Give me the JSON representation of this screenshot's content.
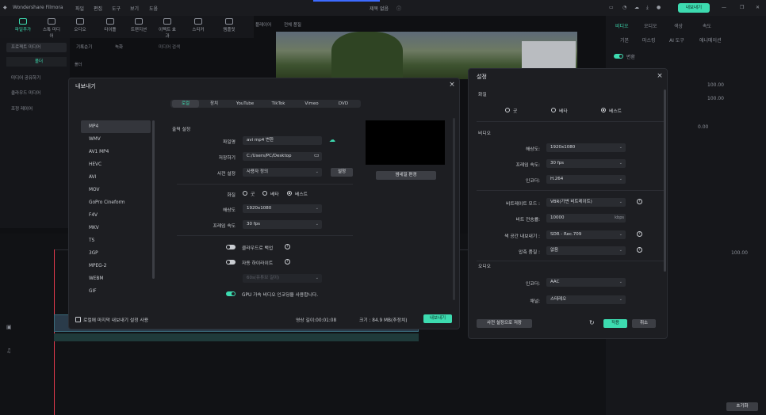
{
  "app": {
    "name": "Wondershare Filmora",
    "menu": [
      "파일",
      "편집",
      "도구",
      "보기",
      "도움"
    ],
    "title": "제목 없음",
    "export_button": "내보내기",
    "accent": "#3ddbb0"
  },
  "toolbar": {
    "items": [
      "파일추가",
      "스톡 미디어",
      "오디오",
      "타이틀",
      "트랜지션",
      "이펙트 효과",
      "스티커",
      "템플릿"
    ]
  },
  "left_panel": {
    "items": [
      "프로젝트 미디어",
      "폴더",
      "미디어 공유하기",
      "클라우드 미디어",
      "조정 레이어"
    ],
    "sort_label": "기록순기",
    "filter_label": "녹화",
    "search_placeholder": "미디어 검색",
    "folder_label": "폴더"
  },
  "preview_bar": {
    "player_label": "플레이어",
    "quality_label": "전체 품질"
  },
  "right_panel": {
    "tabs": [
      "비디오",
      "오디오",
      "색상",
      "속도"
    ],
    "subtabs": [
      "기본",
      "마스킹",
      "AI 도구",
      "애니메이션"
    ],
    "transform_label": "변환",
    "values": [
      "100.00",
      "100.00",
      "0.00",
      "100.00"
    ],
    "footer_button": "초기화"
  },
  "export_dialog": {
    "title": "내보내기",
    "tabs": [
      "로컬",
      "장치",
      "YouTube",
      "TikTok",
      "Vimeo",
      "DVD"
    ],
    "active_tab": "로컬",
    "formats": [
      "MP4",
      "WMV",
      "AV1 MP4",
      "HEVC",
      "AVI",
      "MOV",
      "GoPro Cineform",
      "F4V",
      "MKV",
      "TS",
      "3GP",
      "MPEG-2",
      "WEBM",
      "GIF"
    ],
    "selected_format": "MP4",
    "section_title": "출력 설정",
    "labels": {
      "filename": "파일명",
      "save_to": "저장하기",
      "preset": "사전 설정",
      "quality": "화질",
      "resolution": "해상도",
      "frame_rate": "프레임 속도"
    },
    "values": {
      "filename": "avi mp4 변환",
      "save_to": "C:/Users/PC/Desktop",
      "preset": "사용자 정의",
      "resolution": "1920x1080",
      "frame_rate": "30 fps"
    },
    "quality_options": [
      "굿",
      "베타",
      "베스트"
    ],
    "quality_selected": "베스트",
    "settings_button": "설정",
    "thumbnail_button": "썸네일 편경",
    "toggles": [
      {
        "label": "클라우드로 백업",
        "on": false
      },
      {
        "label": "자동 하이라이트",
        "on": false
      },
      {
        "label": "GPU 가속 비디오 인코딩을 사용합니다.",
        "on": true
      }
    ],
    "highlight_placeholder": "60s(유튜브 길이)",
    "footer": {
      "remember_label": "로컬에 마지막 내보내기 설정 사용",
      "duration_label": "영상 길이:00:01:08",
      "size_label": "크기 : 84.9 MB(추정치)",
      "export_button": "내보내기"
    }
  },
  "settings_dialog": {
    "title": "설정",
    "quality_section": "화질",
    "quality_options": [
      "굿",
      "베타",
      "베스트"
    ],
    "quality_selected": "베스트",
    "video_section": "비디오",
    "rows": [
      {
        "label": "해상도:",
        "value": "1920x1080",
        "help": false
      },
      {
        "label": "프레임 속도:",
        "value": "30 fps",
        "help": false
      },
      {
        "label": "인코더:",
        "value": "H.264",
        "help": false
      },
      {
        "label": "비트레이트 모드 :",
        "value": "VBR(가변 비트레이트)",
        "help": true
      },
      {
        "label": "비트 전송률:",
        "value": "10000",
        "unit": "kbps",
        "help": false
      },
      {
        "label": "색 공간 내보내기 :",
        "value": "SDR - Rec.709",
        "help": true
      },
      {
        "label": "압축 품질 :",
        "value": "없음",
        "help": true
      }
    ],
    "audio_section": "오디오",
    "audio_rows": [
      {
        "label": "인코더:",
        "value": "AAC"
      },
      {
        "label": "채널:",
        "value": "스테레오"
      }
    ],
    "save_preset_button": "사전 설정으로 저장",
    "apply_button": "적용",
    "cancel_button": "취소"
  }
}
